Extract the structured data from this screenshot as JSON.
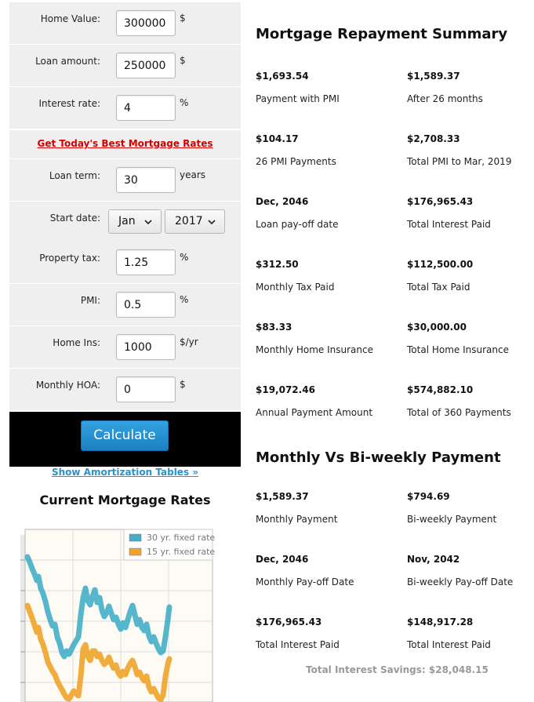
{
  "form": {
    "home_value": {
      "label": "Home Value:",
      "value": "300000",
      "unit": "$"
    },
    "loan_amount": {
      "label": "Loan amount:",
      "value": "250000",
      "unit": "$"
    },
    "interest_rate": {
      "label": "Interest rate:",
      "value": "4",
      "unit": "%"
    },
    "best_rates_link": "Get Today's Best Mortgage Rates",
    "loan_term": {
      "label": "Loan term:",
      "value": "30",
      "unit": "years"
    },
    "start_date": {
      "label": "Start date:",
      "month": "Jan",
      "year": "2017"
    },
    "property_tax": {
      "label": "Property tax:",
      "value": "1.25",
      "unit": "%"
    },
    "pmi": {
      "label": "PMI:",
      "value": "0.5",
      "unit": "%"
    },
    "home_ins": {
      "label": "Home Ins:",
      "value": "1000",
      "unit": "$/yr"
    },
    "monthly_hoa": {
      "label": "Monthly HOA:",
      "value": "0",
      "unit": "$"
    },
    "calculate_label": "Calculate"
  },
  "amortization_link": "Show Amortization Tables »",
  "rates": {
    "title": "Current Mortgage Rates",
    "chart_data": {
      "type": "line",
      "title": "",
      "xlabel": "",
      "ylabel": "",
      "grid": true,
      "legend_position": "top-right",
      "series": [
        {
          "name": "30 yr. fixed rate",
          "color": "#44aec7"
        },
        {
          "name": "15 yr. fixed rate",
          "color": "#f0a32a"
        }
      ]
    }
  },
  "summary": {
    "title": "Mortgage Repayment Summary",
    "items": [
      {
        "value": "$1,693.54",
        "label": "Payment with PMI"
      },
      {
        "value": "$1,589.37",
        "label": "After 26 months"
      },
      {
        "value": "$104.17",
        "label": "26 PMI Payments"
      },
      {
        "value": "$2,708.33",
        "label": "Total PMI to Mar, 2019"
      },
      {
        "value": "Dec, 2046",
        "label": "Loan pay-off date"
      },
      {
        "value": "$176,965.43",
        "label": "Total Interest Paid"
      },
      {
        "value": "$312.50",
        "label": "Monthly Tax Paid"
      },
      {
        "value": "$112,500.00",
        "label": "Total Tax Paid"
      },
      {
        "value": "$83.33",
        "label": "Monthly Home Insurance"
      },
      {
        "value": "$30,000.00",
        "label": "Total Home Insurance"
      },
      {
        "value": "$19,072.46",
        "label": "Annual Payment Amount"
      },
      {
        "value": "$574,882.10",
        "label": "Total of 360 Payments"
      }
    ]
  },
  "biweekly": {
    "title": "Monthly Vs Bi-weekly Payment",
    "items": [
      {
        "value": "$1,589.37",
        "label": "Monthly Payment"
      },
      {
        "value": "$794.69",
        "label": "Bi-weekly Payment"
      },
      {
        "value": "Dec, 2046",
        "label": "Monthly Pay-off Date"
      },
      {
        "value": "Nov, 2042",
        "label": "Bi-weekly Pay-off Date"
      },
      {
        "value": "$176,965.43",
        "label": "Total Interest Paid"
      },
      {
        "value": "$148,917.28",
        "label": "Total Interest Paid"
      }
    ],
    "savings": "Total Interest Savings: $28,048.15"
  }
}
